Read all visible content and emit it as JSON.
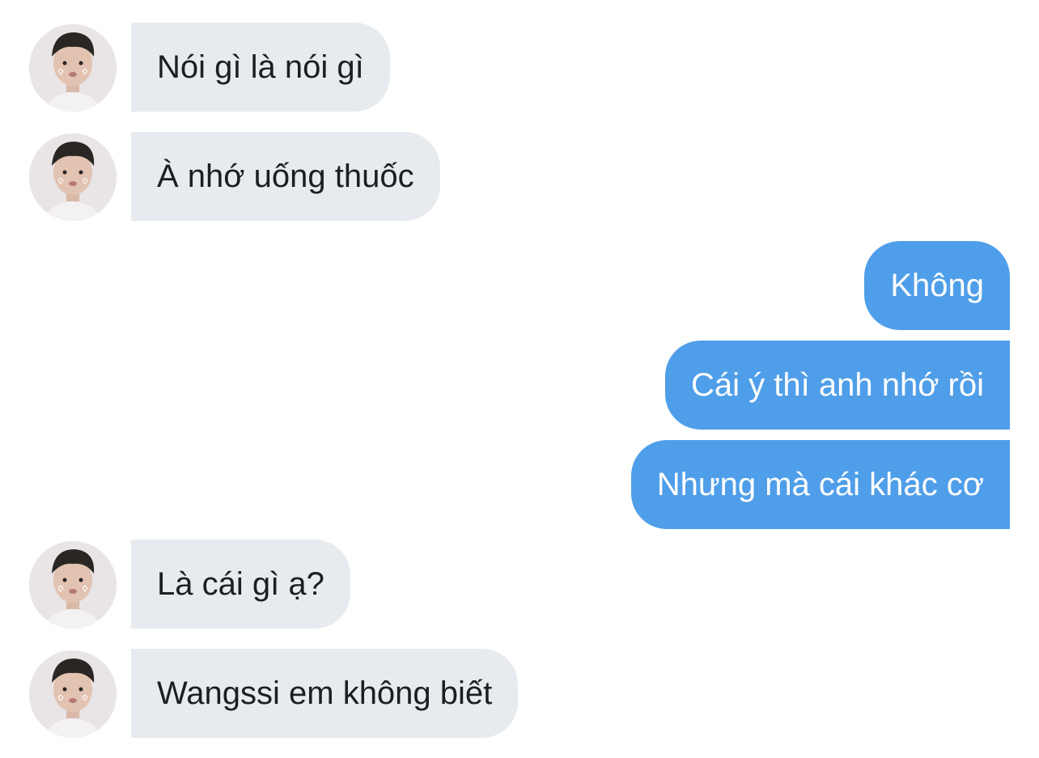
{
  "messages": [
    {
      "direction": "incoming",
      "text": "Nói gì là nói gì",
      "avatar": "user-avatar-icon"
    },
    {
      "direction": "incoming",
      "text": "À nhớ uống thuốc",
      "avatar": "user-avatar-icon"
    },
    {
      "direction": "outgoing",
      "text": "Không"
    },
    {
      "direction": "outgoing",
      "text": "Cái ý thì anh nhớ rồi"
    },
    {
      "direction": "outgoing",
      "text": "Nhưng mà cái khác cơ"
    },
    {
      "direction": "incoming",
      "text": "Là cái gì ạ?",
      "avatar": "user-avatar-icon"
    },
    {
      "direction": "incoming",
      "text": "Wangssi em không biết",
      "avatar": "user-avatar-icon"
    }
  ],
  "colors": {
    "incoming_bubble": "#e7ebef",
    "incoming_text": "#1b1f23",
    "outgoing_bubble": "#4f9ee9",
    "outgoing_text": "#ffffff",
    "background": "#ffffff"
  }
}
